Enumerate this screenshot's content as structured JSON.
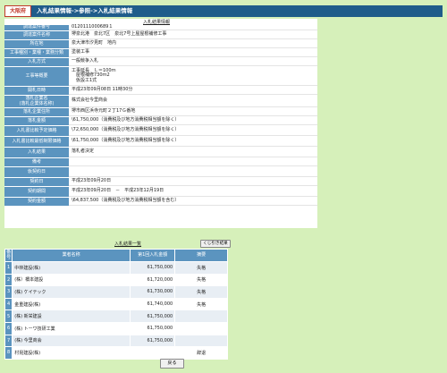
{
  "header": {
    "badge": "大阪府",
    "breadcrumb": "入札結果情報->参照->入札結果情報"
  },
  "info": {
    "title": "入札結果情報",
    "rows": [
      {
        "label": [
          "調達案件番号"
        ],
        "value": [
          "0120111000689１"
        ]
      },
      {
        "label": [
          "調達案件名称"
        ],
        "value": [
          "堺泉北港　泉北7区　泉北7号上屋屋根補修工事"
        ]
      },
      {
        "label": [
          "所在地"
        ],
        "value": [
          "泉大津市汐見町　地内"
        ]
      },
      {
        "label": [
          "工事種別・業種・業務分類"
        ],
        "value": [
          "塗装工事"
        ]
      },
      {
        "label": [
          "入札方式"
        ],
        "value": [
          "一般競争入札"
        ]
      },
      {
        "label": [
          "工事等概要"
        ],
        "value": [
          "工事延長　Ｌ＝100ｍ",
          "　屋根補修730ｍ2",
          "　仮設工1式"
        ]
      },
      {
        "label": [
          "開札日時"
        ],
        "value": [
          "平成23年09月08日 11時30分"
        ]
      },
      {
        "label": [
          "落札企業名",
          "(落札企業体名称)"
        ],
        "value": [
          "株式会社今里商会"
        ]
      },
      {
        "label": [
          "落札企業住所"
        ],
        "value": [
          "堺市西区浜寺元町２丁17Ｇ番地"
        ]
      },
      {
        "label": [
          "落札金額"
        ],
        "value": [
          "\\61,750,000（消費税及び地方消費税相当額を除く）"
        ]
      },
      {
        "label": [
          "入札書比較予定価格"
        ],
        "value": [
          "\\72,650,000（消費税及び地方消費税相当額を除く）"
        ]
      },
      {
        "label": [
          "入札書比較最低制限価格"
        ],
        "value": [
          "\\61,750,000（消費税及び地方消費税相当額を除く）"
        ]
      },
      {
        "label": [
          "入札結果"
        ],
        "value": [
          "落札者決定"
        ]
      },
      {
        "label": [
          "備考"
        ],
        "value": [
          ""
        ]
      },
      {
        "label": [
          "仮契約日"
        ],
        "value": [
          ""
        ]
      },
      {
        "label": [
          "契約日"
        ],
        "value": [
          "平成23年09月20日"
        ]
      },
      {
        "label": [
          "契約期間"
        ],
        "value": [
          "平成23年09月20日　－　平成23年12月19日"
        ]
      },
      {
        "label": [
          "契約金額"
        ],
        "value": [
          "\\64,837,500（消費税及び地方消費税相当額を含む）"
        ]
      }
    ]
  },
  "list": {
    "title": "入札結果一覧",
    "sort_button": "くじ引き結果",
    "columns": [
      "番号",
      "業者名称",
      "第1回入札金額",
      "摘要"
    ],
    "rows": [
      {
        "no": "1",
        "name": "中林建設(株)",
        "amount": "61,750,000",
        "result": "失格"
      },
      {
        "no": "2",
        "name": "(株）橋本建設",
        "amount": "61,720,000",
        "result": "失格"
      },
      {
        "no": "3",
        "name": "(株) ケイテック",
        "amount": "61,730,000",
        "result": "失格"
      },
      {
        "no": "4",
        "name": "金重建設(株)",
        "amount": "61,740,000",
        "result": "失格"
      },
      {
        "no": "5",
        "name": "(株) 新栄建設",
        "amount": "61,750,000",
        "result": ""
      },
      {
        "no": "6",
        "name": "(株) トーワ技研工業",
        "amount": "61,750,000",
        "result": ""
      },
      {
        "no": "7",
        "name": "(株) 今里商会",
        "amount": "61,750,000",
        "result": ""
      },
      {
        "no": "8",
        "name": "村昆建設(株)",
        "amount": "",
        "result": "辞退"
      }
    ]
  },
  "footer": {
    "back_button": "戻る"
  },
  "colors": {
    "header_bg": "#1f5c8a",
    "label_bg": "#5b94bf",
    "page_bg": "#d6f0ba",
    "badge_text": "#c0392b"
  }
}
